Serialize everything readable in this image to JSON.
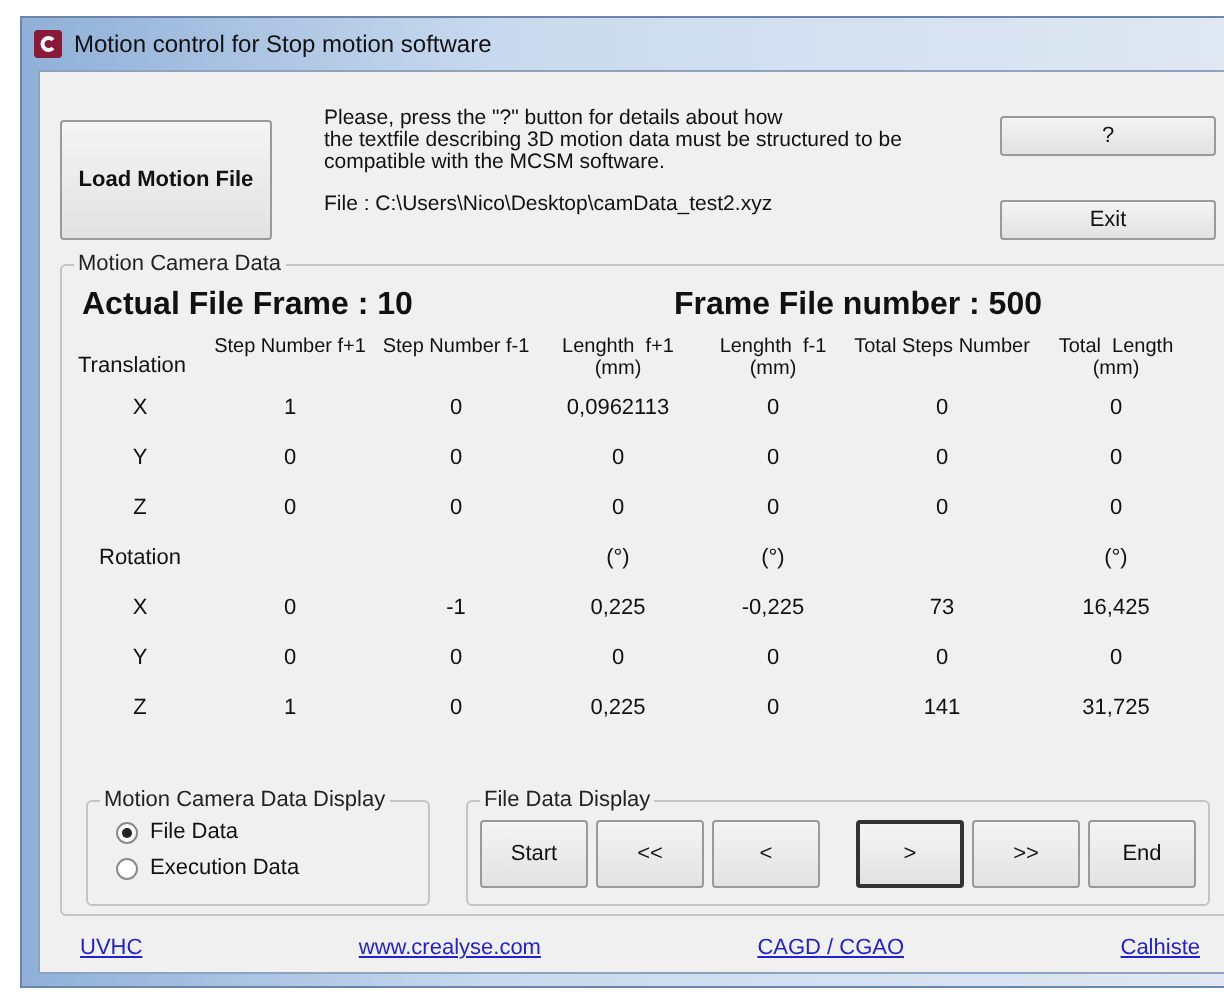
{
  "window": {
    "title": "Motion control for Stop motion software"
  },
  "load_button": "Load Motion File",
  "info_text": "Please, press the \"?\" button for details about how\n the textfile describing 3D motion data must be structured to be\ncompatible with the MCSM software.",
  "file_path": "File : C:\\Users\\Nico\\Desktop\\camData_test2.xyz",
  "help_button": "?",
  "exit_button": "Exit",
  "camera_data": {
    "title": "Motion Camera Data",
    "actual_frame": "Actual File Frame : 10",
    "frame_count": "Frame File number : 500",
    "columns": [
      {
        "label": "Step Number f+1"
      },
      {
        "label": "Step Number f-1"
      },
      {
        "label": "Lenghth  f+1\n(mm)",
        "rotation_unit": "(°)"
      },
      {
        "label": "Lenghth  f-1\n(mm)",
        "rotation_unit": "(°)"
      },
      {
        "label": "Total Steps Number"
      },
      {
        "label": "Total  Length\n(mm)",
        "rotation_unit": "(°)"
      }
    ],
    "sections": [
      {
        "label": "Translation",
        "rows": [
          {
            "axis": "X",
            "cells": [
              "1",
              "0",
              "0,0962113",
              "0",
              "0",
              "0"
            ]
          },
          {
            "axis": "Y",
            "cells": [
              "0",
              "0",
              "0",
              "0",
              "0",
              "0"
            ]
          },
          {
            "axis": "Z",
            "cells": [
              "0",
              "0",
              "0",
              "0",
              "0",
              "0"
            ]
          }
        ]
      },
      {
        "label": "Rotation",
        "rows": [
          {
            "axis": "X",
            "cells": [
              "0",
              "-1",
              "0,225",
              "-0,225",
              "73",
              "16,425"
            ]
          },
          {
            "axis": "Y",
            "cells": [
              "0",
              "0",
              "0",
              "0",
              "0",
              "0"
            ]
          },
          {
            "axis": "Z",
            "cells": [
              "1",
              "0",
              "0,225",
              "0",
              "141",
              "31,725"
            ]
          }
        ]
      }
    ]
  },
  "display_group": {
    "title": "Motion Camera Data Display",
    "options": [
      {
        "label": "File Data",
        "selected": true
      },
      {
        "label": "Execution Data",
        "selected": false
      }
    ]
  },
  "file_display": {
    "title": "File Data Display",
    "buttons": [
      {
        "label": "Start",
        "focused": false
      },
      {
        "label": "<<",
        "focused": false
      },
      {
        "label": "<",
        "focused": false
      },
      {
        "label": ">",
        "focused": true
      },
      {
        "label": ">>",
        "focused": false
      },
      {
        "label": "End",
        "focused": false
      }
    ]
  },
  "links": [
    "UVHC",
    "www.crealyse.com",
    "CAGD / CGAO",
    "Calhiste"
  ]
}
